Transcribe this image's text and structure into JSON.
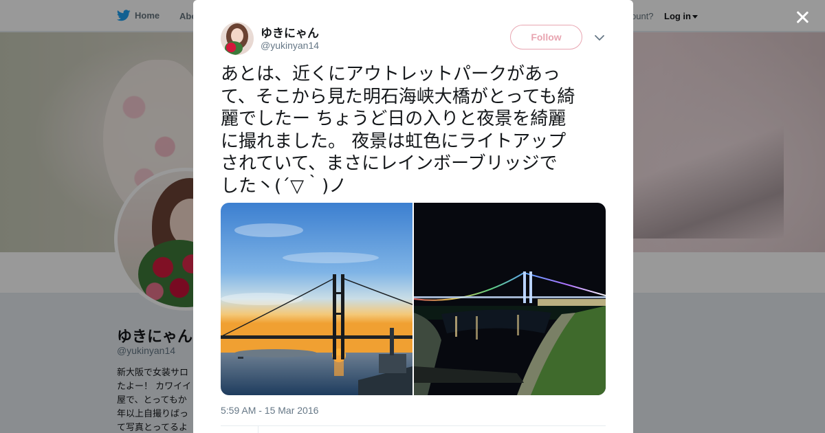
{
  "background_page": {
    "nav": {
      "home_label": "Home",
      "about_label": "Abo",
      "account_prompt": "ccount?",
      "login_label": "Log in"
    },
    "profile": {
      "name": "ゆきにゃん",
      "handle": "@yukinyan14",
      "bio_lines": [
        "新大阪で女装サロ",
        "たよー！ カワイイ",
        "屋で、とってもか",
        "年以上自撮りばっ",
        "て写真とってるよ"
      ]
    }
  },
  "tweet": {
    "author": {
      "name": "ゆきにゃん",
      "handle": "@yukinyan14"
    },
    "follow_label": "Follow",
    "text_lines": [
      "あとは、近くにアウトレットパークがあっ",
      "て、そこから見た明石海峡大橋がとっても綺",
      "麗でしたー ちょうど日の入りと夜景を綺麗",
      "に撮れました。 夜景は虹色にライトアップ",
      "されていて、まさにレインボーブリッジで",
      "した丶(´▽｀)ノ"
    ],
    "photos": [
      {
        "subject": "bridge-sunset-photo"
      },
      {
        "subject": "bridge-night-rainbow-photo"
      }
    ],
    "timestamp": "5:59 AM - 15 Mar 2016"
  },
  "colors": {
    "follow_accent": "#e8a5b1",
    "twitter_blue": "#1da1f2",
    "text_primary": "#14171a",
    "text_secondary": "#657786"
  },
  "icons": [
    "twitter-bird-icon",
    "caret-down-icon",
    "close-icon",
    "chevron-down-icon"
  ]
}
